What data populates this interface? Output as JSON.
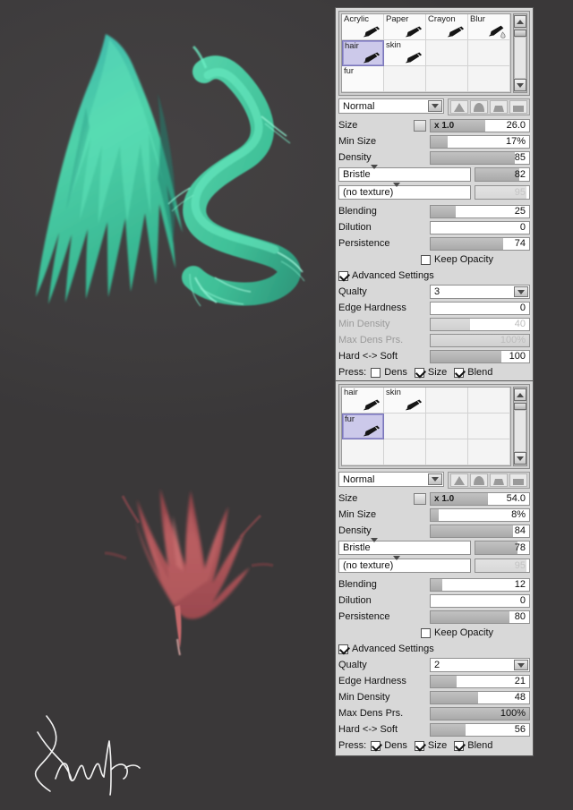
{
  "app": {
    "background_color": "#403e3f",
    "artwork": [
      {
        "name": "teal-hair-wing",
        "color": "#3fd0ae",
        "description": "teal green hair/feather brush stroke study"
      },
      {
        "name": "red-fur-tuft",
        "color": "#b05a5e",
        "description": "dark red fur brush stroke study"
      },
      {
        "name": "artist-signature",
        "color": "#ffffff",
        "description": "white cursive signature"
      }
    ]
  },
  "panels": [
    {
      "id": "hair-brush-panel",
      "brush_grid": {
        "rows": [
          [
            {
              "label": "Acrylic",
              "selected": false,
              "icon": "pen-icon"
            },
            {
              "label": "Paper",
              "selected": false,
              "icon": "pen-icon"
            },
            {
              "label": "Crayon",
              "selected": false,
              "icon": "pen-icon"
            },
            {
              "label": "Blur",
              "selected": false,
              "icon": "pen-blur-icon"
            }
          ],
          [
            {
              "label": "hair",
              "selected": true,
              "icon": "pen-icon"
            },
            {
              "label": "skin",
              "selected": false,
              "icon": "pen-icon"
            },
            {
              "label": "",
              "selected": false,
              "icon": ""
            },
            {
              "label": "",
              "selected": false,
              "icon": ""
            }
          ],
          [
            {
              "label": "fur",
              "selected": false,
              "icon": ""
            },
            {
              "label": "",
              "selected": false,
              "icon": ""
            },
            {
              "label": "",
              "selected": false,
              "icon": ""
            },
            {
              "label": "",
              "selected": false,
              "icon": ""
            }
          ]
        ],
        "scroll_up_icon": "triangle-up-icon",
        "scroll_down_icon": "triangle-down-icon"
      },
      "blend_mode": "Normal",
      "shape_presets": [
        "sharp-triangle-icon",
        "round-dome-icon",
        "flat-trapezoid-icon",
        "square-icon"
      ],
      "size": {
        "label": "Size",
        "multiplier": "x 1.0",
        "value": "26.0",
        "percent": 55
      },
      "min_size": {
        "label": "Min Size",
        "value": "17%",
        "percent": 17
      },
      "density": {
        "label": "Density",
        "value": "85",
        "percent": 85
      },
      "shape": {
        "label": "Bristle",
        "value": "82",
        "percent": 82,
        "dim": false
      },
      "texture": {
        "label": "(no texture)",
        "value": "95",
        "percent": 95,
        "dim": true
      },
      "blending": {
        "label": "Blending",
        "value": "25",
        "percent": 25
      },
      "dilution": {
        "label": "Dilution",
        "value": "0",
        "percent": 0
      },
      "persistence": {
        "label": "Persistence",
        "value": "74",
        "percent": 74
      },
      "keep_opacity": {
        "label": "Keep Opacity",
        "checked": false
      },
      "advanced_settings": {
        "label": "Advanced Settings",
        "checked": true
      },
      "quality": {
        "label": "Qualty",
        "value": "3"
      },
      "edge_hardness": {
        "label": "Edge Hardness",
        "value": "0",
        "percent": 0,
        "dim": false
      },
      "min_density": {
        "label": "Min Density",
        "value": "40",
        "percent": 40,
        "dim": true
      },
      "max_dens_prs": {
        "label": "Max Dens Prs.",
        "value": "100%",
        "percent": 100,
        "dim": true
      },
      "hard_soft": {
        "label": "Hard <-> Soft",
        "value": "100",
        "percent": 100,
        "dim": false
      },
      "press": {
        "label": "Press:",
        "items": [
          {
            "label": "Dens",
            "checked": false
          },
          {
            "label": "Size",
            "checked": true
          },
          {
            "label": "Blend",
            "checked": true
          }
        ]
      }
    },
    {
      "id": "fur-brush-panel",
      "brush_grid": {
        "rows": [
          [
            {
              "label": "hair",
              "selected": false,
              "icon": "pen-icon"
            },
            {
              "label": "skin",
              "selected": false,
              "icon": "pen-icon"
            },
            {
              "label": "",
              "selected": false,
              "icon": ""
            },
            {
              "label": "",
              "selected": false,
              "icon": ""
            }
          ],
          [
            {
              "label": "fur",
              "selected": true,
              "icon": "pen-icon"
            },
            {
              "label": "",
              "selected": false,
              "icon": ""
            },
            {
              "label": "",
              "selected": false,
              "icon": ""
            },
            {
              "label": "",
              "selected": false,
              "icon": ""
            }
          ],
          [
            {
              "label": "",
              "selected": false,
              "icon": ""
            },
            {
              "label": "",
              "selected": false,
              "icon": ""
            },
            {
              "label": "",
              "selected": false,
              "icon": ""
            },
            {
              "label": "",
              "selected": false,
              "icon": ""
            }
          ]
        ],
        "scroll_up_icon": "triangle-up-icon",
        "scroll_down_icon": "triangle-down-icon"
      },
      "blend_mode": "Normal",
      "shape_presets": [
        "sharp-triangle-icon",
        "round-dome-icon",
        "flat-trapezoid-icon",
        "square-icon"
      ],
      "size": {
        "label": "Size",
        "multiplier": "x 1.0",
        "value": "54.0",
        "percent": 58
      },
      "min_size": {
        "label": "Min Size",
        "value": "8%",
        "percent": 8
      },
      "density": {
        "label": "Density",
        "value": "84",
        "percent": 84
      },
      "shape": {
        "label": "Bristle",
        "value": "78",
        "percent": 78,
        "dim": false
      },
      "texture": {
        "label": "(no texture)",
        "value": "95",
        "percent": 95,
        "dim": true
      },
      "blending": {
        "label": "Blending",
        "value": "12",
        "percent": 12
      },
      "dilution": {
        "label": "Dilution",
        "value": "0",
        "percent": 0
      },
      "persistence": {
        "label": "Persistence",
        "value": "80",
        "percent": 80
      },
      "keep_opacity": {
        "label": "Keep Opacity",
        "checked": false
      },
      "advanced_settings": {
        "label": "Advanced Settings",
        "checked": true
      },
      "quality": {
        "label": "Qualty",
        "value": "2"
      },
      "edge_hardness": {
        "label": "Edge Hardness",
        "value": "21",
        "percent": 21,
        "dim": false
      },
      "min_density": {
        "label": "Min Density",
        "value": "48",
        "percent": 48,
        "dim": false
      },
      "max_dens_prs": {
        "label": "Max Dens Prs.",
        "value": "100%",
        "percent": 100,
        "dim": false
      },
      "hard_soft": {
        "label": "Hard <-> Soft",
        "value": "56",
        "percent": 35,
        "dim": false
      },
      "press": {
        "label": "Press:",
        "items": [
          {
            "label": "Dens",
            "checked": true
          },
          {
            "label": "Size",
            "checked": true
          },
          {
            "label": "Blend",
            "checked": true
          }
        ]
      }
    }
  ]
}
